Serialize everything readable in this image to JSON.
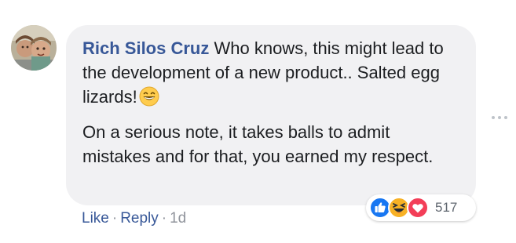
{
  "comment": {
    "author": "Rich Silos Cruz",
    "paragraph1_text": "Who knows, this might lead to the development of a new product.. Salted egg lizards!",
    "paragraph1_emoji": "grinning-face-emoji",
    "paragraph2_text": "On a serious note, it takes balls to admit mistakes and for that, you earned my respect.",
    "reactions": {
      "types": [
        "like",
        "haha",
        "love"
      ],
      "count": "517"
    },
    "actions": {
      "like_label": "Like",
      "reply_label": "Reply",
      "separator": "·",
      "timestamp": "1d"
    }
  },
  "icons": {
    "avatar": "user-avatar-photo",
    "more": "more-options-icon"
  },
  "colors": {
    "author": "#385898",
    "bubble_bg": "#f1f1f3",
    "like_blue": "#1877f2",
    "love_red": "#f33e58",
    "haha_yellow": "#f7b125",
    "meta_gray": "#90949c"
  }
}
